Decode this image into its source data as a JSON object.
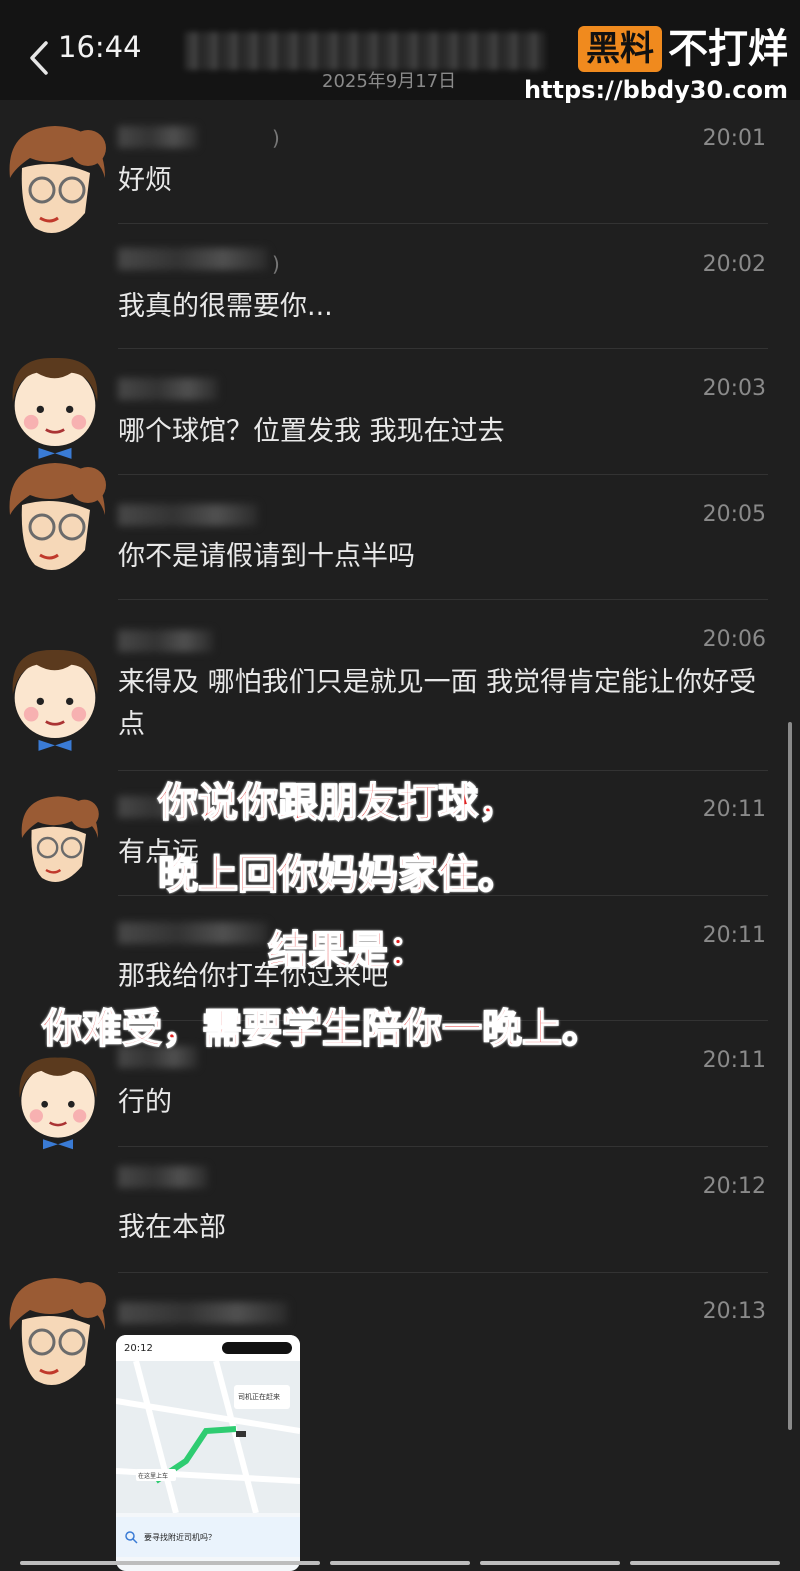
{
  "status": {
    "time": "16:44"
  },
  "header": {
    "date": "2025年9月17日"
  },
  "watermark": {
    "badge": "黑料",
    "brand": "不打烊",
    "url": "https://bbdy30.com"
  },
  "messages": [
    {
      "time": "20:01",
      "text": "好烦",
      "sender": "female"
    },
    {
      "time": "20:02",
      "text": "我真的很需要你...",
      "sender": "female"
    },
    {
      "time": "20:03",
      "text": "哪个球馆？位置发我  我现在过去",
      "sender": "male"
    },
    {
      "time": "20:05",
      "text": "你不是请假请到十点半吗",
      "sender": "female"
    },
    {
      "time": "20:06",
      "text": "来得及   哪怕我们只是就见一面  我觉得肯定能让你好受点",
      "sender": "male"
    },
    {
      "time": "20:11",
      "text": "有点远",
      "sender": "female"
    },
    {
      "time": "20:11",
      "text": "那我给你打车你过来吧",
      "sender": "female"
    },
    {
      "time": "20:11",
      "text": "行的",
      "sender": "male"
    },
    {
      "time": "20:12",
      "text": "我在本部",
      "sender": "female"
    },
    {
      "time": "20:13",
      "text": "",
      "sender": "female"
    }
  ],
  "overlay": {
    "line1": "你说你跟朋友打球，",
    "line2": "晚上回你妈妈家住。",
    "line3": "结果是：",
    "line4": "你难受，需要学生陪你一晚上。"
  },
  "thumbnail": {
    "time": "20:12",
    "nav_banner": "司机正在赶来",
    "pickup_label": "在这里上车",
    "prompt": "要寻找附近司机吗？"
  },
  "colors": {
    "overlay_red": "#e02020",
    "badge_orange": "#f08a1e",
    "background": "#1f1f1f"
  }
}
